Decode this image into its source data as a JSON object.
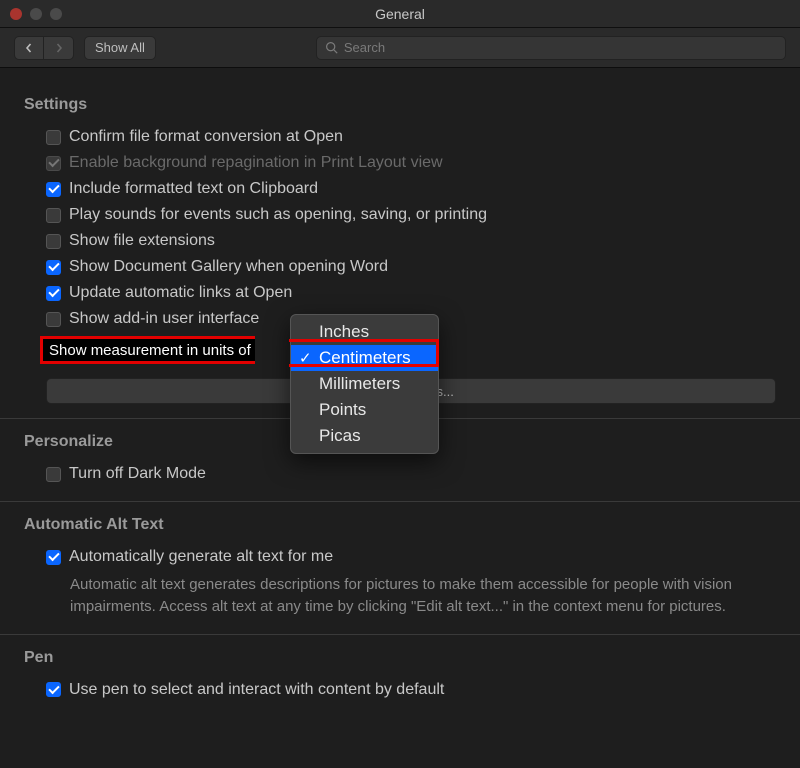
{
  "window": {
    "title": "General"
  },
  "toolbar": {
    "show_all": "Show All",
    "search_placeholder": "Search"
  },
  "sections": {
    "settings": {
      "title": "Settings",
      "items": {
        "confirm_conversion": "Confirm file format conversion at Open",
        "background_repag": "Enable background repagination in Print Layout view",
        "include_formatted": "Include formatted text on Clipboard",
        "play_sounds": "Play sounds for events such as opening, saving, or printing",
        "show_ext": "Show file extensions",
        "show_gallery": "Show Document Gallery when opening Word",
        "update_links": "Update automatic links at Open",
        "show_addin": "Show add-in user interface",
        "measurement_label": "Show measurement in units of"
      },
      "web_options": "Web Options...",
      "units": {
        "options": [
          "Inches",
          "Centimeters",
          "Millimeters",
          "Points",
          "Picas"
        ],
        "selected": "Centimeters"
      }
    },
    "personalize": {
      "title": "Personalize",
      "dark_mode": "Turn off Dark Mode"
    },
    "alt_text": {
      "title": "Automatic Alt Text",
      "auto": "Automatically generate alt text for me",
      "desc": "Automatic alt text generates descriptions for pictures to make them accessible for people with vision impairments. Access alt text at any time by clicking \"Edit alt text...\" in the context menu for pictures."
    },
    "pen": {
      "title": "Pen",
      "use_pen": "Use pen to select and interact with content by default"
    }
  }
}
